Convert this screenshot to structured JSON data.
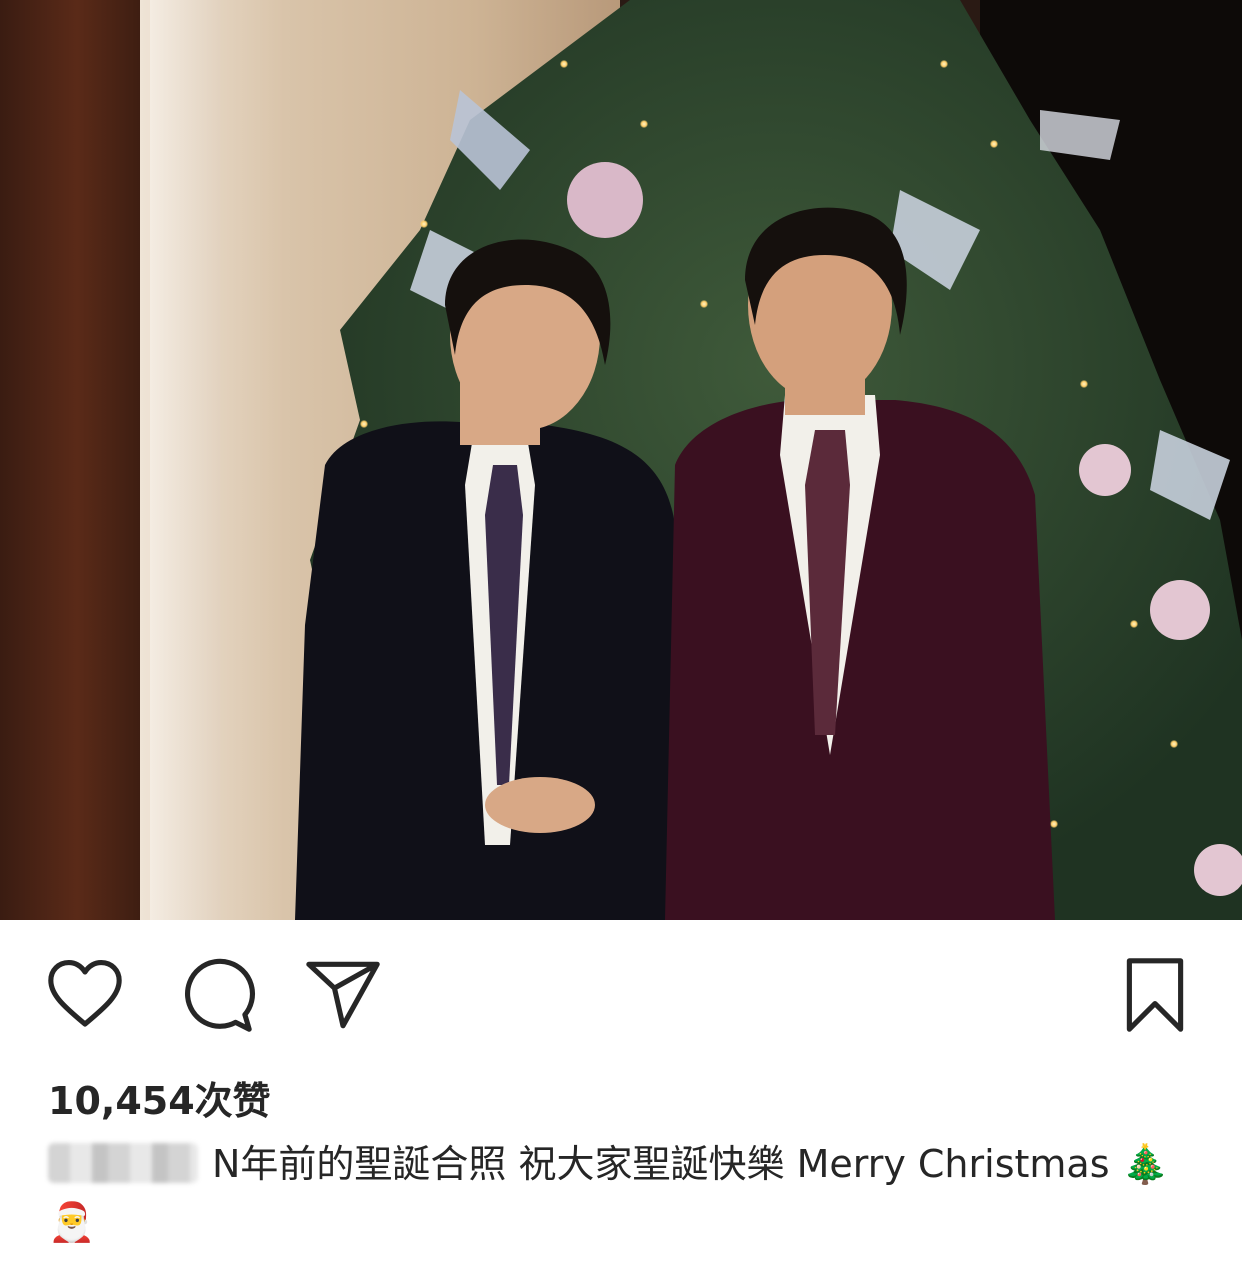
{
  "post": {
    "image_alt": "",
    "likes_text": "10,454次赞",
    "caption_text": "N年前的聖誕合照 祝大家聖誕快樂 Merry Christmas",
    "caption_emojis": "🎄 🎅"
  },
  "actions": {
    "like": "heart-icon",
    "comment": "comment-icon",
    "share": "send-icon",
    "save": "bookmark-icon"
  },
  "colors": {
    "text": "#262626",
    "icon": "#262626",
    "background": "#ffffff"
  }
}
